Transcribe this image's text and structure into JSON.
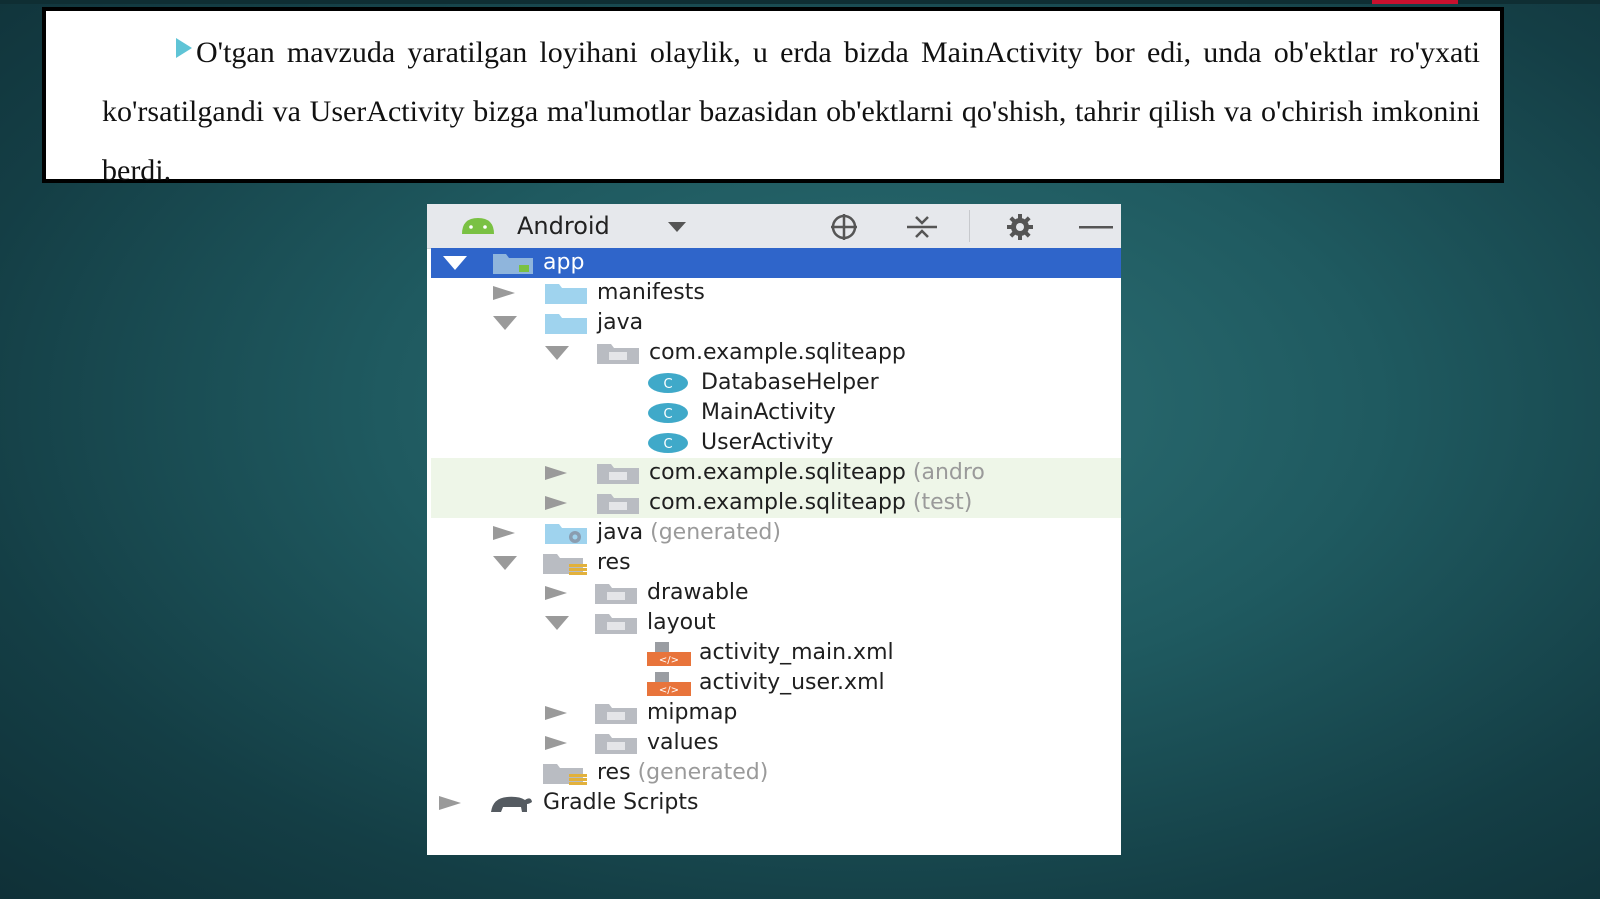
{
  "slide": {
    "paragraph": "O'tgan mavzuda yaratilgan loyihani olaylik, u erda bizda MainActivity bor edi, unda ob'ektlar ro'yxati ko'rsatilgandi va UserActivity bizga ma'lumotlar bazasidan ob'ektlarni qo'shish, tahrir qilish va o'chirish imkonini berdi."
  },
  "project_panel": {
    "view_label": "Android",
    "toolbar_icons": [
      "android-icon",
      "dropdown-chevron-icon",
      "locate-icon",
      "collapse-all-icon",
      "gear-icon",
      "minimize-icon"
    ],
    "colors": {
      "selection": "#2f65ca",
      "toolbar": "#e6e8ec",
      "android_green": "#7ac143",
      "class_icon": "#3fa9c9",
      "xml_icon": "#e8743b",
      "folder": "#9fd3ee"
    },
    "tree": [
      {
        "label": "app",
        "hint": "",
        "selected": true,
        "expanded": true
      },
      {
        "label": "manifests",
        "hint": "",
        "expanded": false
      },
      {
        "label": "java",
        "hint": "",
        "expanded": true
      },
      {
        "label": "com.example.sqliteapp",
        "hint": "",
        "expanded": true
      },
      {
        "label": "DatabaseHelper",
        "hint": ""
      },
      {
        "label": "MainActivity",
        "hint": ""
      },
      {
        "label": "UserActivity",
        "hint": ""
      },
      {
        "label": "com.example.sqliteapp",
        "hint": "(andro",
        "expanded": false
      },
      {
        "label": "com.example.sqliteapp",
        "hint": "(test)",
        "expanded": false
      },
      {
        "label": "java",
        "hint": "(generated)",
        "expanded": false
      },
      {
        "label": "res",
        "hint": "",
        "expanded": true
      },
      {
        "label": "drawable",
        "hint": "",
        "expanded": false
      },
      {
        "label": "layout",
        "hint": "",
        "expanded": true
      },
      {
        "label": "activity_main.xml",
        "hint": ""
      },
      {
        "label": "activity_user.xml",
        "hint": ""
      },
      {
        "label": "mipmap",
        "hint": "",
        "expanded": false
      },
      {
        "label": "values",
        "hint": "",
        "expanded": false
      },
      {
        "label": "res",
        "hint": "(generated)"
      },
      {
        "label": "Gradle Scripts",
        "hint": "",
        "expanded": false
      }
    ]
  }
}
